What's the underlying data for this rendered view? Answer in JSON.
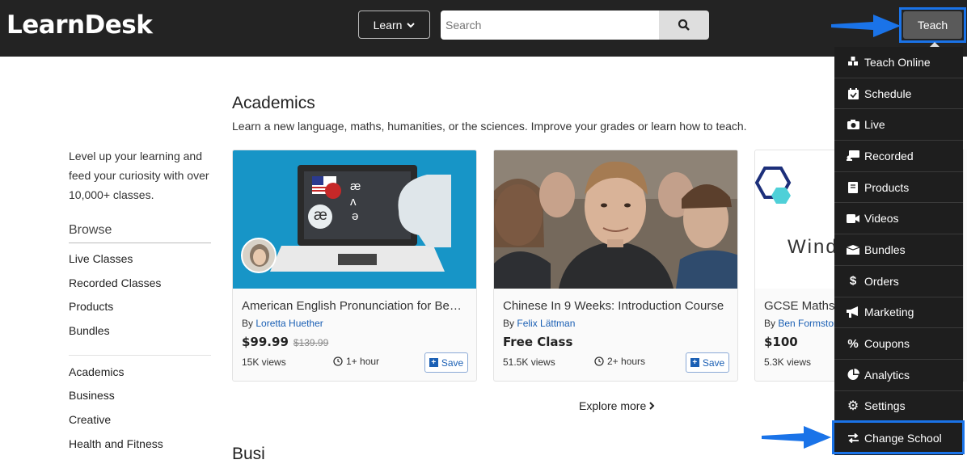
{
  "header": {
    "logo": "LearnDesk",
    "learn_label": "Learn",
    "search_placeholder": "Search",
    "teach_label": "Teach"
  },
  "sidebar": {
    "tagline": "Level up your learning and feed your curiosity with over 10,000+ classes.",
    "browse_title": "Browse",
    "group1": [
      "Live Classes",
      "Recorded Classes",
      "Products",
      "Bundles"
    ],
    "group2": [
      "Academics",
      "Business",
      "Creative",
      "Health and Fitness"
    ]
  },
  "main": {
    "title": "Academics",
    "subtitle": "Learn a new language, maths, humanities, or the sciences. Improve your grades or learn how to teach.",
    "explore": "Explore more",
    "next_section_peek": "Busi"
  },
  "cards": [
    {
      "title": "American English Pronunciation for Begi...",
      "by": "By",
      "author": "Loretta Huether",
      "price": "$99.99",
      "old_price": "$139.99",
      "views": "15K views",
      "duration": "1+ hour",
      "save": "Save",
      "img_glyphs": [
        "æ",
        "ʌ",
        "ə",
        "æ"
      ]
    },
    {
      "title": "Chinese In 9 Weeks: Introduction Course",
      "by": "By",
      "author": "Felix Lättman",
      "price": "Free Class",
      "views": "51.5K views",
      "duration": "2+ hours",
      "save": "Save"
    },
    {
      "title": "GCSE Maths",
      "by": "By",
      "author": "Ben Formston",
      "price": "$100",
      "views": "5.3K views",
      "img_text": "Wind"
    }
  ],
  "dropdown": {
    "items": [
      {
        "label": "Teach Online",
        "icon": "teach-online-icon"
      },
      {
        "label": "Schedule",
        "icon": "calendar-check-icon"
      },
      {
        "label": "Live",
        "icon": "camera-icon"
      },
      {
        "label": "Recorded",
        "icon": "recorded-icon"
      },
      {
        "label": "Products",
        "icon": "book-icon"
      },
      {
        "label": "Videos",
        "icon": "video-icon"
      },
      {
        "label": "Bundles",
        "icon": "box-icon"
      },
      {
        "label": "Orders",
        "icon": "dollar-icon"
      },
      {
        "label": "Marketing",
        "icon": "megaphone-icon"
      },
      {
        "label": "Coupons",
        "icon": "percent-icon"
      },
      {
        "label": "Analytics",
        "icon": "pie-chart-icon"
      },
      {
        "label": "Settings",
        "icon": "gear-icon"
      },
      {
        "label": "Change School",
        "icon": "exchange-icon"
      }
    ]
  },
  "colors": {
    "topbar": "#232323",
    "accent": "#1a73e8",
    "link": "#1a5fb4",
    "dropdown": "#1e1e1e"
  }
}
